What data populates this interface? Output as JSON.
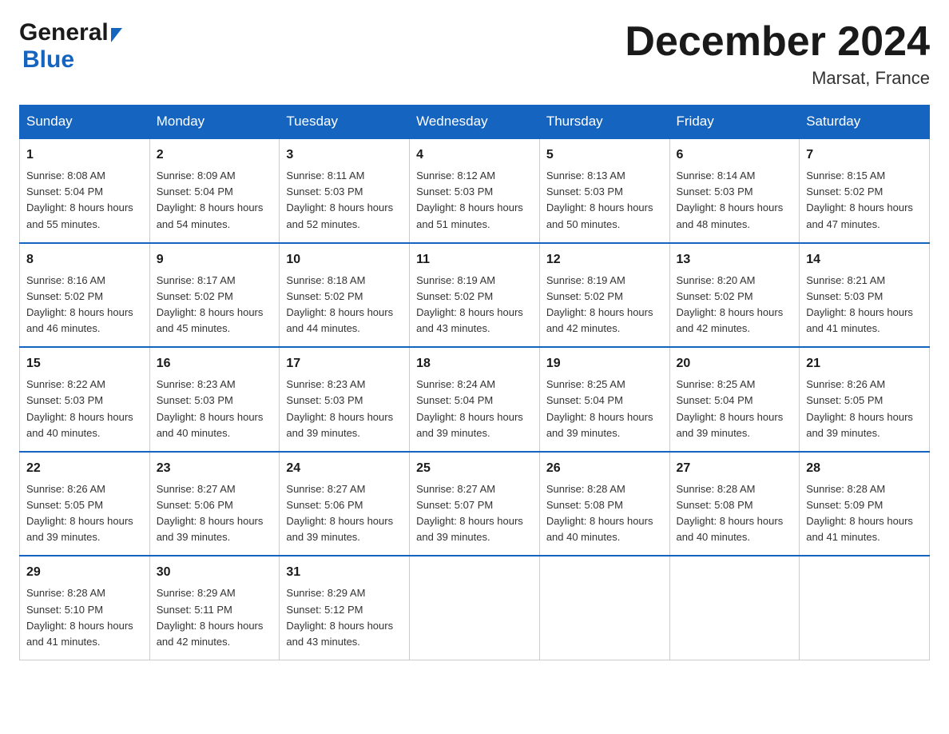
{
  "header": {
    "logo_general": "General",
    "logo_blue": "Blue",
    "title": "December 2024",
    "subtitle": "Marsat, France"
  },
  "weekdays": [
    "Sunday",
    "Monday",
    "Tuesday",
    "Wednesday",
    "Thursday",
    "Friday",
    "Saturday"
  ],
  "weeks": [
    [
      {
        "day": "1",
        "sunrise": "8:08 AM",
        "sunset": "5:04 PM",
        "daylight": "8 hours and 55 minutes."
      },
      {
        "day": "2",
        "sunrise": "8:09 AM",
        "sunset": "5:04 PM",
        "daylight": "8 hours and 54 minutes."
      },
      {
        "day": "3",
        "sunrise": "8:11 AM",
        "sunset": "5:03 PM",
        "daylight": "8 hours and 52 minutes."
      },
      {
        "day": "4",
        "sunrise": "8:12 AM",
        "sunset": "5:03 PM",
        "daylight": "8 hours and 51 minutes."
      },
      {
        "day": "5",
        "sunrise": "8:13 AM",
        "sunset": "5:03 PM",
        "daylight": "8 hours and 50 minutes."
      },
      {
        "day": "6",
        "sunrise": "8:14 AM",
        "sunset": "5:03 PM",
        "daylight": "8 hours and 48 minutes."
      },
      {
        "day": "7",
        "sunrise": "8:15 AM",
        "sunset": "5:02 PM",
        "daylight": "8 hours and 47 minutes."
      }
    ],
    [
      {
        "day": "8",
        "sunrise": "8:16 AM",
        "sunset": "5:02 PM",
        "daylight": "8 hours and 46 minutes."
      },
      {
        "day": "9",
        "sunrise": "8:17 AM",
        "sunset": "5:02 PM",
        "daylight": "8 hours and 45 minutes."
      },
      {
        "day": "10",
        "sunrise": "8:18 AM",
        "sunset": "5:02 PM",
        "daylight": "8 hours and 44 minutes."
      },
      {
        "day": "11",
        "sunrise": "8:19 AM",
        "sunset": "5:02 PM",
        "daylight": "8 hours and 43 minutes."
      },
      {
        "day": "12",
        "sunrise": "8:19 AM",
        "sunset": "5:02 PM",
        "daylight": "8 hours and 42 minutes."
      },
      {
        "day": "13",
        "sunrise": "8:20 AM",
        "sunset": "5:02 PM",
        "daylight": "8 hours and 42 minutes."
      },
      {
        "day": "14",
        "sunrise": "8:21 AM",
        "sunset": "5:03 PM",
        "daylight": "8 hours and 41 minutes."
      }
    ],
    [
      {
        "day": "15",
        "sunrise": "8:22 AM",
        "sunset": "5:03 PM",
        "daylight": "8 hours and 40 minutes."
      },
      {
        "day": "16",
        "sunrise": "8:23 AM",
        "sunset": "5:03 PM",
        "daylight": "8 hours and 40 minutes."
      },
      {
        "day": "17",
        "sunrise": "8:23 AM",
        "sunset": "5:03 PM",
        "daylight": "8 hours and 39 minutes."
      },
      {
        "day": "18",
        "sunrise": "8:24 AM",
        "sunset": "5:04 PM",
        "daylight": "8 hours and 39 minutes."
      },
      {
        "day": "19",
        "sunrise": "8:25 AM",
        "sunset": "5:04 PM",
        "daylight": "8 hours and 39 minutes."
      },
      {
        "day": "20",
        "sunrise": "8:25 AM",
        "sunset": "5:04 PM",
        "daylight": "8 hours and 39 minutes."
      },
      {
        "day": "21",
        "sunrise": "8:26 AM",
        "sunset": "5:05 PM",
        "daylight": "8 hours and 39 minutes."
      }
    ],
    [
      {
        "day": "22",
        "sunrise": "8:26 AM",
        "sunset": "5:05 PM",
        "daylight": "8 hours and 39 minutes."
      },
      {
        "day": "23",
        "sunrise": "8:27 AM",
        "sunset": "5:06 PM",
        "daylight": "8 hours and 39 minutes."
      },
      {
        "day": "24",
        "sunrise": "8:27 AM",
        "sunset": "5:06 PM",
        "daylight": "8 hours and 39 minutes."
      },
      {
        "day": "25",
        "sunrise": "8:27 AM",
        "sunset": "5:07 PM",
        "daylight": "8 hours and 39 minutes."
      },
      {
        "day": "26",
        "sunrise": "8:28 AM",
        "sunset": "5:08 PM",
        "daylight": "8 hours and 40 minutes."
      },
      {
        "day": "27",
        "sunrise": "8:28 AM",
        "sunset": "5:08 PM",
        "daylight": "8 hours and 40 minutes."
      },
      {
        "day": "28",
        "sunrise": "8:28 AM",
        "sunset": "5:09 PM",
        "daylight": "8 hours and 41 minutes."
      }
    ],
    [
      {
        "day": "29",
        "sunrise": "8:28 AM",
        "sunset": "5:10 PM",
        "daylight": "8 hours and 41 minutes."
      },
      {
        "day": "30",
        "sunrise": "8:29 AM",
        "sunset": "5:11 PM",
        "daylight": "8 hours and 42 minutes."
      },
      {
        "day": "31",
        "sunrise": "8:29 AM",
        "sunset": "5:12 PM",
        "daylight": "8 hours and 43 minutes."
      },
      null,
      null,
      null,
      null
    ]
  ],
  "labels": {
    "sunrise": "Sunrise:",
    "sunset": "Sunset:",
    "daylight": "Daylight:"
  }
}
